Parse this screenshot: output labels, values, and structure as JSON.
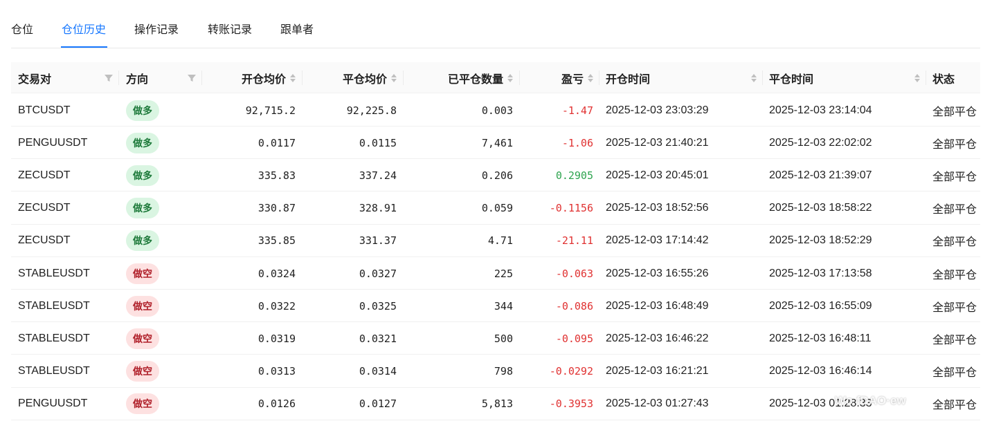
{
  "tabs": [
    {
      "label": "仓位"
    },
    {
      "label": "仓位历史"
    },
    {
      "label": "操作记录"
    },
    {
      "label": "转账记录"
    },
    {
      "label": "跟单者"
    }
  ],
  "active_tab": "仓位历史",
  "columns": {
    "pair": "交易对",
    "direction": "方向",
    "open_avg": "开仓均价",
    "close_avg": "平仓均价",
    "closed_qty": "已平仓数量",
    "pnl": "盈亏",
    "open_time": "开仓时间",
    "close_time": "平仓时间",
    "status": "状态"
  },
  "rows": [
    {
      "pair": "BTCUSDT",
      "direction": "做多",
      "side": "long",
      "open_avg": "92,715.2",
      "close_avg": "92,225.8",
      "closed_qty": "0.003",
      "pnl": "-1.47",
      "pnl_sign": "neg",
      "open_time": "2025-12-03 23:03:29",
      "close_time": "2025-12-03 23:14:04",
      "status": "全部平仓"
    },
    {
      "pair": "PENGUUSDT",
      "direction": "做多",
      "side": "long",
      "open_avg": "0.0117",
      "close_avg": "0.0115",
      "closed_qty": "7,461",
      "pnl": "-1.06",
      "pnl_sign": "neg",
      "open_time": "2025-12-03 21:40:21",
      "close_time": "2025-12-03 22:02:02",
      "status": "全部平仓"
    },
    {
      "pair": "ZECUSDT",
      "direction": "做多",
      "side": "long",
      "open_avg": "335.83",
      "close_avg": "337.24",
      "closed_qty": "0.206",
      "pnl": "0.2905",
      "pnl_sign": "pos",
      "open_time": "2025-12-03 20:45:01",
      "close_time": "2025-12-03 21:39:07",
      "status": "全部平仓"
    },
    {
      "pair": "ZECUSDT",
      "direction": "做多",
      "side": "long",
      "open_avg": "330.87",
      "close_avg": "328.91",
      "closed_qty": "0.059",
      "pnl": "-0.1156",
      "pnl_sign": "neg",
      "open_time": "2025-12-03 18:52:56",
      "close_time": "2025-12-03 18:58:22",
      "status": "全部平仓"
    },
    {
      "pair": "ZECUSDT",
      "direction": "做多",
      "side": "long",
      "open_avg": "335.85",
      "close_avg": "331.37",
      "closed_qty": "4.71",
      "pnl": "-21.11",
      "pnl_sign": "neg",
      "open_time": "2025-12-03 17:14:42",
      "close_time": "2025-12-03 18:52:29",
      "status": "全部平仓"
    },
    {
      "pair": "STABLEUSDT",
      "direction": "做空",
      "side": "short",
      "open_avg": "0.0324",
      "close_avg": "0.0327",
      "closed_qty": "225",
      "pnl": "-0.063",
      "pnl_sign": "neg",
      "open_time": "2025-12-03 16:55:26",
      "close_time": "2025-12-03 17:13:58",
      "status": "全部平仓"
    },
    {
      "pair": "STABLEUSDT",
      "direction": "做空",
      "side": "short",
      "open_avg": "0.0322",
      "close_avg": "0.0325",
      "closed_qty": "344",
      "pnl": "-0.086",
      "pnl_sign": "neg",
      "open_time": "2025-12-03 16:48:49",
      "close_time": "2025-12-03 16:55:09",
      "status": "全部平仓"
    },
    {
      "pair": "STABLEUSDT",
      "direction": "做空",
      "side": "short",
      "open_avg": "0.0319",
      "close_avg": "0.0321",
      "closed_qty": "500",
      "pnl": "-0.095",
      "pnl_sign": "neg",
      "open_time": "2025-12-03 16:46:22",
      "close_time": "2025-12-03 16:48:11",
      "status": "全部平仓"
    },
    {
      "pair": "STABLEUSDT",
      "direction": "做空",
      "side": "short",
      "open_avg": "0.0313",
      "close_avg": "0.0314",
      "closed_qty": "798",
      "pnl": "-0.0292",
      "pnl_sign": "neg",
      "open_time": "2025-12-03 16:21:21",
      "close_time": "2025-12-03 16:46:14",
      "status": "全部平仓"
    },
    {
      "pair": "PENGUUSDT",
      "direction": "做空",
      "side": "short",
      "open_avg": "0.0126",
      "close_avg": "0.0127",
      "closed_qty": "5,813",
      "pnl": "-0.3953",
      "pnl_sign": "neg",
      "open_time": "2025-12-03 01:27:43",
      "close_time": "2025-12-03 01:28:33",
      "status": "全部平仓"
    }
  ],
  "watermark": "Wo fDAO·ew",
  "colors": {
    "accent": "#1677ff",
    "pnl_negative": "#e03131",
    "pnl_positive": "#2ea44f",
    "long_badge_bg": "#daf5e2",
    "short_badge_bg": "#fde1e1"
  },
  "icons": {
    "filter": "filter-icon",
    "sort": "sort-icon"
  }
}
